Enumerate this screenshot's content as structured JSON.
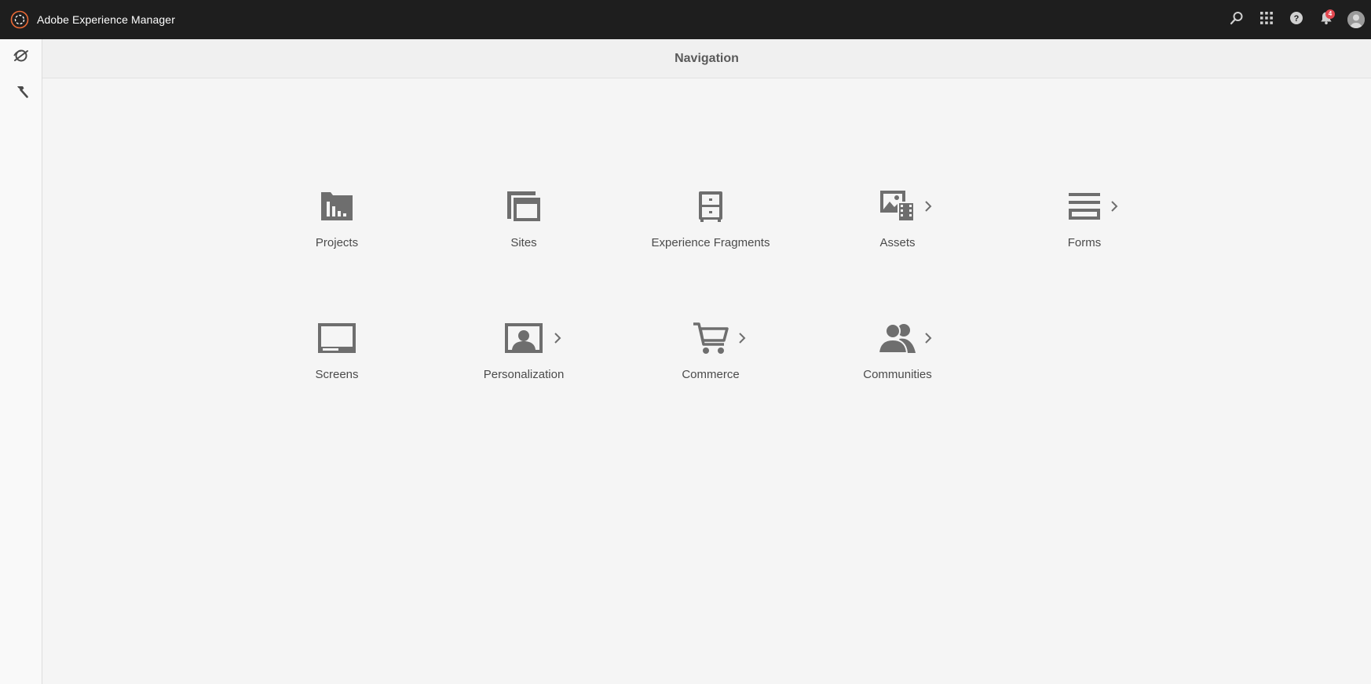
{
  "app": {
    "title": "Adobe Experience Manager",
    "logo_icon": "aem-logo-icon"
  },
  "topbar": {
    "actions": [
      {
        "name": "search-icon"
      },
      {
        "name": "solutions-grid-icon"
      },
      {
        "name": "help-icon"
      },
      {
        "name": "notifications-bell-icon",
        "badge": "4"
      },
      {
        "name": "user-avatar"
      }
    ]
  },
  "rail": {
    "items": [
      {
        "name": "navigation-toggle-icon"
      },
      {
        "name": "tools-hammer-icon"
      }
    ]
  },
  "header": {
    "title": "Navigation"
  },
  "navigation": {
    "items": [
      {
        "label": "Projects",
        "icon": "projects-folder-icon",
        "has_submenu": false
      },
      {
        "label": "Sites",
        "icon": "sites-pages-icon",
        "has_submenu": false
      },
      {
        "label": "Experience Fragments",
        "icon": "experience-fragments-cabinet-icon",
        "has_submenu": false
      },
      {
        "label": "Assets",
        "icon": "assets-media-icon",
        "has_submenu": true
      },
      {
        "label": "Forms",
        "icon": "forms-icon",
        "has_submenu": true
      },
      {
        "label": "Screens",
        "icon": "screens-monitor-icon",
        "has_submenu": false
      },
      {
        "label": "Personalization",
        "icon": "personalization-icon",
        "has_submenu": true
      },
      {
        "label": "Commerce",
        "icon": "commerce-cart-icon",
        "has_submenu": true
      },
      {
        "label": "Communities",
        "icon": "communities-people-icon",
        "has_submenu": true
      }
    ]
  },
  "colors": {
    "topbar_bg": "#1e1e1e",
    "brand_accent": "#eb6a36",
    "icon_gray": "#6e6e6e",
    "badge_red": "#e34850"
  }
}
